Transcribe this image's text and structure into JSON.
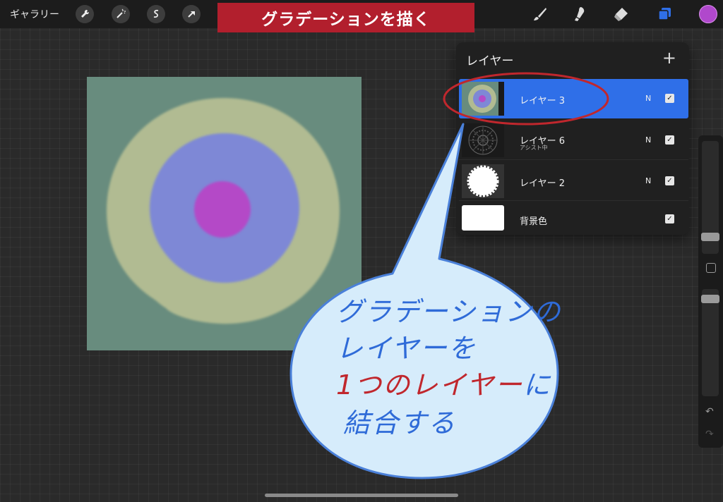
{
  "topbar": {
    "gallery_label": "ギャラリー",
    "title_banner": "グラデーションを描く"
  },
  "colors": {
    "accent": "#2f6fe8",
    "current_color": "#b048cc",
    "banner": "#b21f2d",
    "callout_text": "#2f6bd8",
    "callout_red": "#c0272d"
  },
  "icons": [
    "wrench-icon",
    "magic-wand-icon",
    "selection-icon",
    "transform-arrow-icon",
    "brush-icon",
    "smudge-icon",
    "eraser-icon",
    "layers-icon"
  ],
  "layers_panel": {
    "title": "レイヤー",
    "add_label": "+",
    "layers": [
      {
        "name": "レイヤー 3",
        "sub": "",
        "blend": "N",
        "visible": true,
        "active": true
      },
      {
        "name": "レイヤー 6",
        "sub": "アシスト中",
        "blend": "N",
        "visible": true,
        "active": false
      },
      {
        "name": "レイヤー 2",
        "sub": "",
        "blend": "N",
        "visible": true,
        "active": false
      },
      {
        "name": "背景色",
        "sub": "",
        "blend": "",
        "visible": true,
        "active": false
      }
    ]
  },
  "callout": {
    "line1": "グラデーションの",
    "line2": "レイヤーを",
    "line3_red": "1つのレイヤー",
    "line3_rest": "に",
    "line4": "結合する"
  },
  "sidebar": {
    "undo_label": "↶",
    "redo_label": "↷"
  }
}
